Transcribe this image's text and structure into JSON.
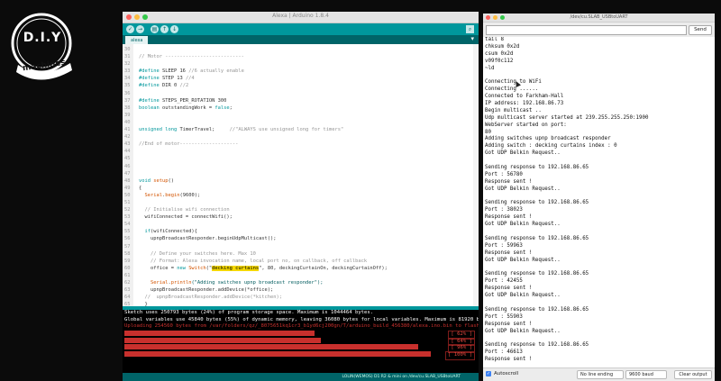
{
  "logo": {
    "line1": "D.I.Y",
    "line2": "machines"
  },
  "ide": {
    "title": "Alexa | Arduino 1.8.4",
    "tab_label": "alexa",
    "status": "LOLIN(WEMOS) D1 R2 & mini on /dev/cu.SLAB_USBtoUART",
    "code_lines": [
      {
        "n": "30",
        "segments": [
          {
            "t": "",
            "c": "c-tx"
          }
        ]
      },
      {
        "n": "31",
        "segments": [
          {
            "t": "// Motor ---------------------------",
            "c": "c-cm"
          }
        ]
      },
      {
        "n": "32",
        "segments": [
          {
            "t": "",
            "c": "c-tx"
          }
        ]
      },
      {
        "n": "33",
        "segments": [
          {
            "t": "#define ",
            "c": "c-kw"
          },
          {
            "t": "SLEEP 16 ",
            "c": "c-tx"
          },
          {
            "t": "//6 actually enable",
            "c": "c-cm"
          }
        ]
      },
      {
        "n": "34",
        "segments": [
          {
            "t": "#define ",
            "c": "c-kw"
          },
          {
            "t": "STEP 13 ",
            "c": "c-tx"
          },
          {
            "t": "//4",
            "c": "c-cm"
          }
        ]
      },
      {
        "n": "35",
        "segments": [
          {
            "t": "#define ",
            "c": "c-kw"
          },
          {
            "t": "DIR 0 ",
            "c": "c-tx"
          },
          {
            "t": "//2",
            "c": "c-cm"
          }
        ]
      },
      {
        "n": "36",
        "segments": [
          {
            "t": "",
            "c": "c-tx"
          }
        ]
      },
      {
        "n": "37",
        "segments": [
          {
            "t": "#define ",
            "c": "c-kw"
          },
          {
            "t": "STEPS_PER_ROTATION 300",
            "c": "c-tx"
          }
        ]
      },
      {
        "n": "38",
        "segments": [
          {
            "t": "boolean ",
            "c": "c-kw"
          },
          {
            "t": "outstandingWork = ",
            "c": "c-tx"
          },
          {
            "t": "false",
            "c": "c-kw"
          },
          {
            "t": ";",
            "c": "c-tx"
          }
        ]
      },
      {
        "n": "39",
        "segments": [
          {
            "t": "",
            "c": "c-tx"
          }
        ]
      },
      {
        "n": "40",
        "segments": [
          {
            "t": "",
            "c": "c-tx"
          }
        ]
      },
      {
        "n": "41",
        "segments": [
          {
            "t": "unsigned long ",
            "c": "c-kw"
          },
          {
            "t": "TimerTravel;     ",
            "c": "c-tx"
          },
          {
            "t": "//\"ALWAYS use unsigned long for timers\"",
            "c": "c-cm"
          }
        ]
      },
      {
        "n": "42",
        "segments": [
          {
            "t": "",
            "c": "c-tx"
          }
        ]
      },
      {
        "n": "43",
        "segments": [
          {
            "t": "//End of motor--------------------",
            "c": "c-cm"
          }
        ]
      },
      {
        "n": "44",
        "segments": [
          {
            "t": "",
            "c": "c-tx"
          }
        ]
      },
      {
        "n": "45",
        "segments": [
          {
            "t": "",
            "c": "c-tx"
          }
        ]
      },
      {
        "n": "46",
        "segments": [
          {
            "t": "",
            "c": "c-tx"
          }
        ]
      },
      {
        "n": "47",
        "segments": [
          {
            "t": "",
            "c": "c-tx"
          }
        ]
      },
      {
        "n": "48",
        "segments": [
          {
            "t": "void ",
            "c": "c-kw"
          },
          {
            "t": "setup",
            "c": "c-fn"
          },
          {
            "t": "()",
            "c": "c-tx"
          }
        ]
      },
      {
        "n": "49",
        "segments": [
          {
            "t": "{",
            "c": "c-tx"
          }
        ]
      },
      {
        "n": "50",
        "segments": [
          {
            "t": "  ",
            "c": "c-tx"
          },
          {
            "t": "Serial",
            "c": "c-fn"
          },
          {
            "t": ".",
            "c": "c-tx"
          },
          {
            "t": "begin",
            "c": "c-fn"
          },
          {
            "t": "(9600);",
            "c": "c-tx"
          }
        ]
      },
      {
        "n": "51",
        "segments": [
          {
            "t": "",
            "c": "c-tx"
          }
        ]
      },
      {
        "n": "52",
        "segments": [
          {
            "t": "  // Initialise wifi connection",
            "c": "c-cm"
          }
        ]
      },
      {
        "n": "53",
        "segments": [
          {
            "t": "  wifiConnected = connectWifi();",
            "c": "c-tx"
          }
        ]
      },
      {
        "n": "54",
        "segments": [
          {
            "t": "",
            "c": "c-tx"
          }
        ]
      },
      {
        "n": "55",
        "segments": [
          {
            "t": "  ",
            "c": "c-tx"
          },
          {
            "t": "if",
            "c": "c-kw"
          },
          {
            "t": "(wifiConnected){",
            "c": "c-tx"
          }
        ]
      },
      {
        "n": "56",
        "segments": [
          {
            "t": "    upnpBroadcastResponder.beginUdpMulticast();",
            "c": "c-tx"
          }
        ]
      },
      {
        "n": "57",
        "segments": [
          {
            "t": "",
            "c": "c-tx"
          }
        ]
      },
      {
        "n": "58",
        "segments": [
          {
            "t": "    // Define your switches here. Max 10",
            "c": "c-cm"
          }
        ]
      },
      {
        "n": "59",
        "segments": [
          {
            "t": "    // Format: Alexa invocation name, local port no, on callback, off callback",
            "c": "c-cm"
          }
        ]
      },
      {
        "n": "60",
        "segments": [
          {
            "t": "    office = ",
            "c": "c-tx"
          },
          {
            "t": "new ",
            "c": "c-kw"
          },
          {
            "t": "Switch",
            "c": "c-fn"
          },
          {
            "t": "(\"",
            "c": "c-tx"
          },
          {
            "t": "decking curtains",
            "c": "hl"
          },
          {
            "t": "\", 80, deckingCurtainOn, deckingCurtainOff);",
            "c": "c-tx"
          }
        ]
      },
      {
        "n": "61",
        "segments": [
          {
            "t": "",
            "c": "c-tx"
          }
        ]
      },
      {
        "n": "62",
        "segments": [
          {
            "t": "    ",
            "c": "c-tx"
          },
          {
            "t": "Serial",
            "c": "c-fn"
          },
          {
            "t": ".",
            "c": "c-tx"
          },
          {
            "t": "println",
            "c": "c-fn"
          },
          {
            "t": "(\"Adding switches upnp broadcast responder\");",
            "c": "c-st"
          }
        ]
      },
      {
        "n": "63",
        "segments": [
          {
            "t": "    upnpBroadcastResponder.addDevice(*office);",
            "c": "c-tx"
          }
        ]
      },
      {
        "n": "64",
        "segments": [
          {
            "t": "  //  upnpBroadcastResponder.addDevice(*kitchen);",
            "c": "c-cm"
          }
        ]
      },
      {
        "n": "65",
        "segments": [
          {
            "t": "  }",
            "c": "c-tx"
          }
        ]
      },
      {
        "n": "66",
        "segments": [
          {
            "t": "",
            "c": "c-tx"
          }
        ]
      },
      {
        "n": "67",
        "segments": [
          {
            "t": "",
            "c": "c-tx"
          }
        ]
      },
      {
        "n": "68",
        "segments": [
          {
            "t": "",
            "c": "c-tx"
          }
        ]
      },
      {
        "n": "69",
        "segments": [
          {
            "t": "// Motor -------------------",
            "c": "c-cm"
          }
        ]
      }
    ],
    "console_lines": [
      {
        "text": "Sketch uses 250793 bytes (24%) of program storage space. Maximum is 1044464 bytes.",
        "cls": ""
      },
      {
        "text": "Global variables use 45840 bytes (55%) of dynamic memory, leaving 36080 bytes for local variables. Maximum is 81920 bytes.",
        "cls": ""
      },
      {
        "text": "Uploading 254560 bytes from /var/folders/qz/_8075651kq1cr3_b1yd6cj200gn/T/arduino_build_456380/alexa.ino.bin to flash",
        "cls": "red"
      }
    ],
    "progress": [
      {
        "fill": 0.62,
        "label": "[ 62% ]"
      },
      {
        "fill": 0.64,
        "label": "[ 64% ]"
      },
      {
        "fill": 0.96,
        "label": "[ 96% ]"
      },
      {
        "fill": 1.0,
        "label": "[ 100% ]"
      }
    ]
  },
  "serial": {
    "title": "/dev/cu.SLAB_USBtoUART",
    "send_label": "Send",
    "lines": [
      "tail 8",
      "chksum 0x2d",
      "csum 0x2d",
      "v09f0c112",
      "~ld",
      "",
      "Connecting to WiFi",
      "Connecting ......",
      "Connected to Farkham-Hall",
      "IP address: 192.168.86.73",
      "Begin multicast ..",
      "Udp multicast server started at 239.255.255.250:1900",
      "WebServer started on port:",
      "80",
      "Adding switches upnp broadcast responder",
      "Adding switch : decking curtains index : 0",
      "Got UDP Belkin Request..",
      "",
      "Sending response to 192.168.86.65",
      "Port : 56780",
      "Response sent !",
      "Got UDP Belkin Request..",
      "",
      "Sending response to 192.168.86.65",
      "Port : 38023",
      "Response sent !",
      "Got UDP Belkin Request..",
      "",
      "Sending response to 192.168.86.65",
      "Port : 59963",
      "Response sent !",
      "Got UDP Belkin Request..",
      "",
      "Sending response to 192.168.86.65",
      "Port : 42455",
      "Response sent !",
      "Got UDP Belkin Request..",
      "",
      "Sending response to 192.168.86.65",
      "Port : 55903",
      "Response sent !",
      "Got UDP Belkin Request..",
      "",
      "Sending response to 192.168.86.65",
      "Port : 46613",
      "Response sent !"
    ],
    "autoscroll_label": "Autoscroll",
    "line_ending": "No line ending",
    "baud": "9600 baud",
    "clear_label": "Clear output"
  }
}
